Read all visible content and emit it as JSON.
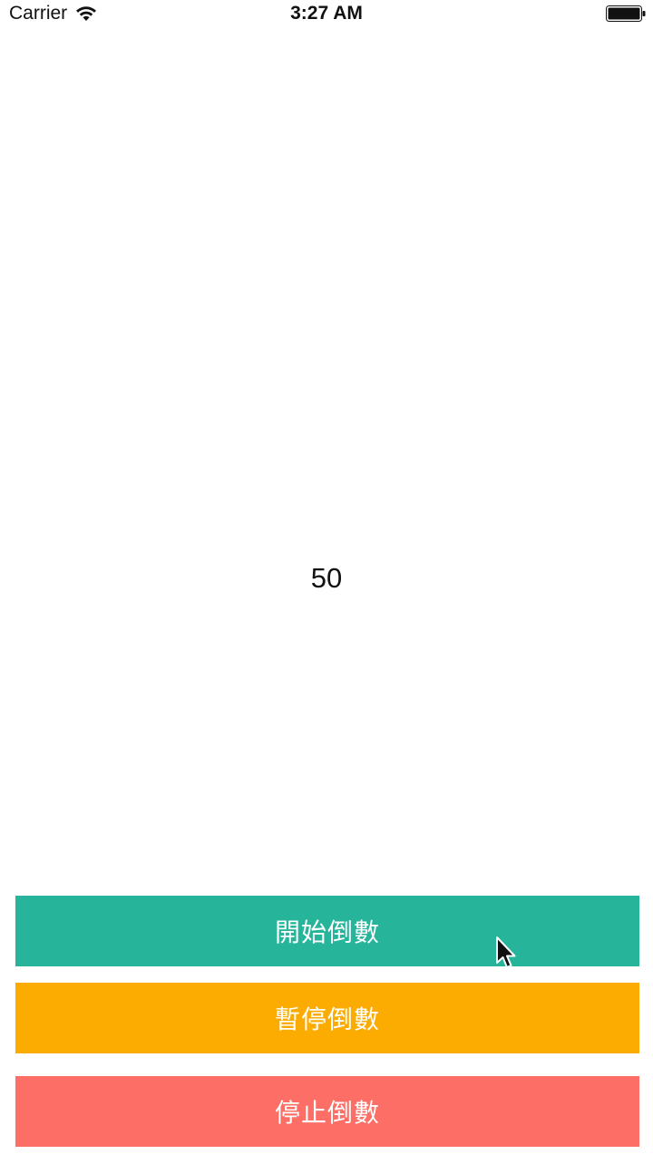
{
  "status_bar": {
    "carrier": "Carrier",
    "time": "3:27 AM",
    "wifi_icon": "wifi-icon",
    "battery_icon": "battery-icon"
  },
  "counter": {
    "value": "50"
  },
  "buttons": {
    "start": {
      "label": "開始倒數",
      "color": "#26b59a"
    },
    "pause": {
      "label": "暫停倒數",
      "color": "#fcab00"
    },
    "stop": {
      "label": "停止倒數",
      "color": "#fd6e66"
    }
  },
  "pointer": {
    "icon": "mouse-pointer-icon"
  }
}
